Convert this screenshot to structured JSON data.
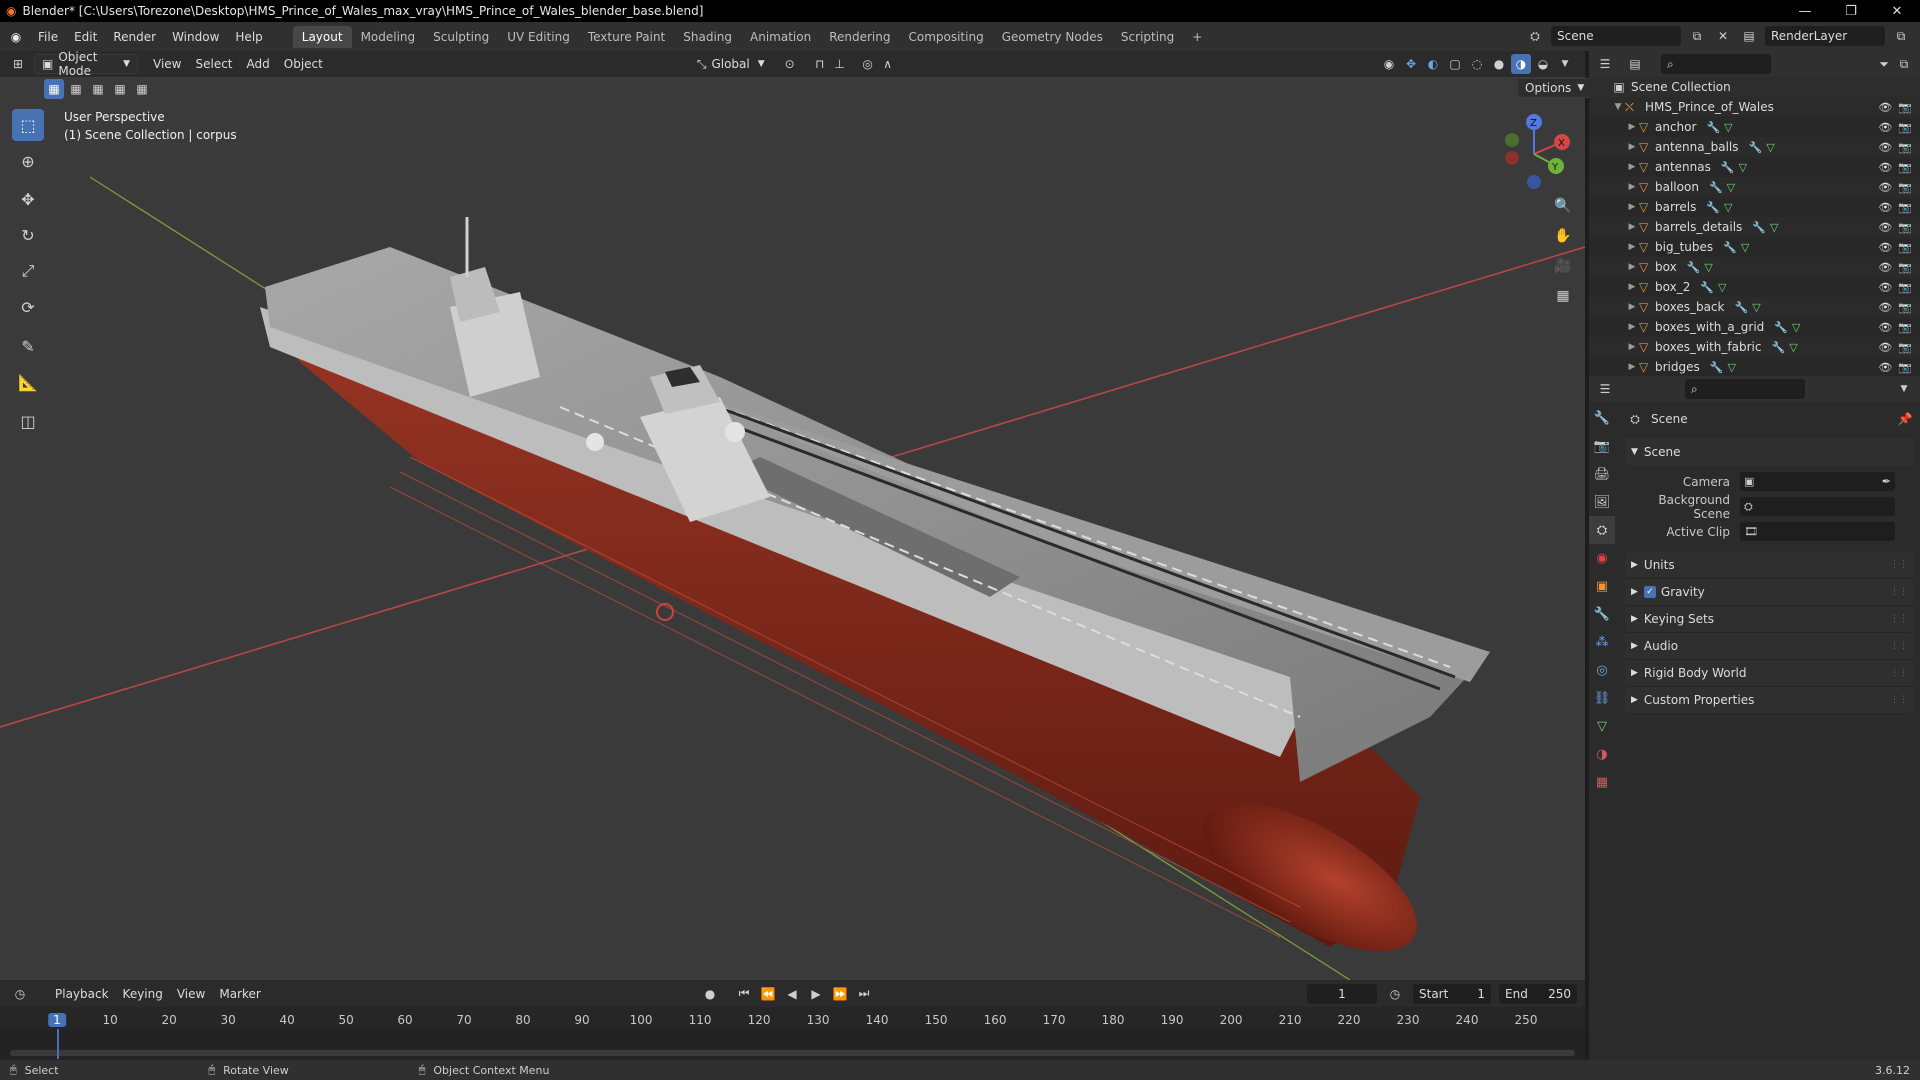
{
  "window": {
    "title": "Blender* [C:\\Users\\Torezone\\Desktop\\HMS_Prince_of_Wales_max_vray\\HMS_Prince_of_Wales_blender_base.blend]",
    "controls": [
      "—",
      "❐",
      "✕"
    ]
  },
  "menubar": {
    "items": [
      "File",
      "Edit",
      "Render",
      "Window",
      "Help"
    ],
    "workspaces": [
      "Layout",
      "Modeling",
      "Sculpting",
      "UV Editing",
      "Texture Paint",
      "Shading",
      "Animation",
      "Rendering",
      "Compositing",
      "Geometry Nodes",
      "Scripting"
    ],
    "active_workspace": "Layout",
    "add_tab": "+",
    "scene": "Scene",
    "view_layer": "RenderLayer"
  },
  "viewport_header": {
    "mode": "Object Mode",
    "menus": [
      "View",
      "Select",
      "Add",
      "Object"
    ],
    "transform_orientation": "Global",
    "options": "Options"
  },
  "viewport": {
    "perspective": "User Perspective",
    "collection_info": "(1) Scene Collection | corpus",
    "gizmo": {
      "x": "X",
      "y": "Y",
      "z": "Z"
    },
    "colors": {
      "bg": "#393939",
      "grid": "#414141",
      "x_axis": "#c44a4a",
      "y_axis": "#7fa03a",
      "hull_red": "#8a2a1e",
      "deck_gray": "#8c8c8c"
    }
  },
  "toolbar": {
    "tools": [
      "select-box-icon",
      "cursor-icon",
      "move-icon",
      "rotate-icon",
      "scale-icon",
      "transform-icon",
      "annotate-icon",
      "measure-icon",
      "add-cube-icon"
    ],
    "active_tool": "select-box-icon"
  },
  "outliner": {
    "root": "Scene Collection",
    "collection": "HMS_Prince_of_Wales",
    "items": [
      "anchor",
      "antenna_balls",
      "antennas",
      "balloon",
      "barrels",
      "barrels_details",
      "big_tubes",
      "box",
      "box_2",
      "boxes_back",
      "boxes_with_a_grid",
      "boxes_with_fabric",
      "bridges"
    ]
  },
  "properties": {
    "context": "Scene",
    "panel": "Scene",
    "fields": [
      {
        "label": "Camera",
        "value": ""
      },
      {
        "label": "Background Scene",
        "value": ""
      },
      {
        "label": "Active Clip",
        "value": ""
      }
    ],
    "subpanels": [
      "Units",
      "Gravity",
      "Keying Sets",
      "Audio",
      "Rigid Body World",
      "Custom Properties"
    ],
    "gravity_checked": true
  },
  "timeline": {
    "menus": [
      "Playback",
      "Keying",
      "View",
      "Marker"
    ],
    "current_frame": "1",
    "start_label": "Start",
    "start": "1",
    "end_label": "End",
    "end": "250",
    "ruler": [
      "1",
      "10",
      "20",
      "30",
      "40",
      "50",
      "60",
      "70",
      "80",
      "90",
      "100",
      "110",
      "120",
      "130",
      "140",
      "150",
      "160",
      "170",
      "180",
      "190",
      "200",
      "210",
      "220",
      "230",
      "240",
      "250"
    ]
  },
  "statusbar": {
    "select": "Select",
    "rotate": "Rotate View",
    "context_menu": "Object Context Menu",
    "version": "3.6.12"
  }
}
